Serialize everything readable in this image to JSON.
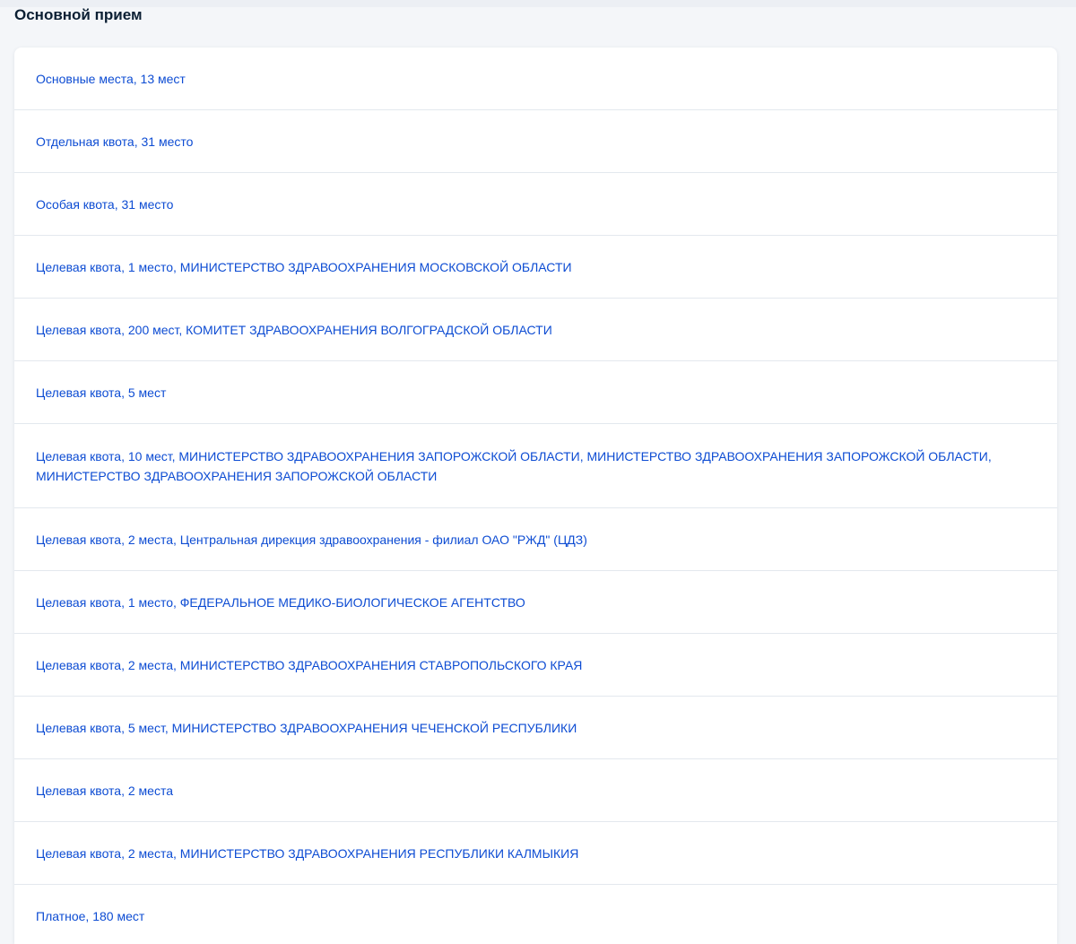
{
  "section": {
    "title": "Основной прием"
  },
  "quotas": [
    "Основные места, 13 мест",
    "Отдельная квота, 31 место",
    "Особая квота, 31 место",
    "Целевая квота, 1 место, МИНИСТЕРСТВО ЗДРАВООХРАНЕНИЯ МОСКОВСКОЙ ОБЛАСТИ",
    "Целевая квота, 200 мест, КОМИТЕТ ЗДРАВООХРАНЕНИЯ ВОЛГОГРАДСКОЙ ОБЛАСТИ",
    "Целевая квота, 5 мест",
    "Целевая квота, 10 мест, МИНИСТЕРСТВО ЗДРАВООХРАНЕНИЯ ЗАПОРОЖСКОЙ ОБЛАСТИ, МИНИСТЕРСТВО ЗДРАВООХРАНЕНИЯ ЗАПОРОЖСКОЙ ОБЛАСТИ, МИНИСТЕРСТВО ЗДРАВООХРАНЕНИЯ ЗАПОРОЖСКОЙ ОБЛАСТИ",
    "Целевая квота, 2 места, Центральная дирекция здравоохранения - филиал ОАО \"РЖД\" (ЦДЗ)",
    "Целевая квота, 1 место, ФЕДЕРАЛЬНОЕ МЕДИКО-БИОЛОГИЧЕСКОЕ АГЕНТСТВО",
    "Целевая квота, 2 места, МИНИСТЕРСТВО ЗДРАВООХРАНЕНИЯ СТАВРОПОЛЬСКОГО КРАЯ",
    "Целевая квота, 5 мест, МИНИСТЕРСТВО ЗДРАВООХРАНЕНИЯ ЧЕЧЕНСКОЙ РЕСПУБЛИКИ",
    "Целевая квота, 2 места",
    "Целевая квота, 2 места, МИНИСТЕРСТВО ЗДРАВООХРАНЕНИЯ РЕСПУБЛИКИ КАЛМЫКИЯ",
    "Платное, 180 мест"
  ],
  "colors": {
    "link": "#0d4cd3",
    "title": "#0b1f33",
    "background": "#f4f6f9",
    "divider": "#e3e8ee"
  }
}
